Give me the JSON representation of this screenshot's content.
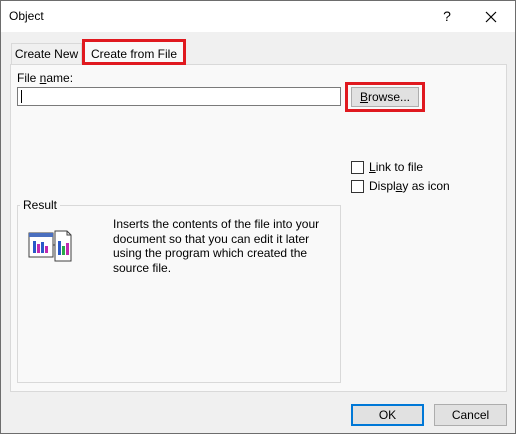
{
  "window": {
    "title": "Object",
    "help_label": "?"
  },
  "tabs": [
    {
      "label": "Create New",
      "active": false
    },
    {
      "label": "Create from File",
      "active": true
    }
  ],
  "file": {
    "label_prefix": "File ",
    "label_accel": "n",
    "label_suffix": "ame:",
    "value": "",
    "placeholder": ""
  },
  "browse": {
    "accel": "B",
    "rest": "rowse..."
  },
  "options": {
    "link_accel": "L",
    "link_rest": "ink to file",
    "link_checked": false,
    "display_prefix": "Displ",
    "display_accel": "a",
    "display_rest": "y as icon",
    "display_checked": false
  },
  "result": {
    "legend": "Result",
    "description": "Inserts the contents of the file into your document so that you can edit it later using the program which created the source file.",
    "icon": "embedded-document-icon"
  },
  "footer": {
    "ok_label": "OK",
    "cancel_label": "Cancel"
  },
  "colors": {
    "highlight": "#e0191f",
    "focus_border": "#0078d7",
    "panel_bg": "#f9f9f9",
    "dialog_bg": "#f0f0f0"
  }
}
